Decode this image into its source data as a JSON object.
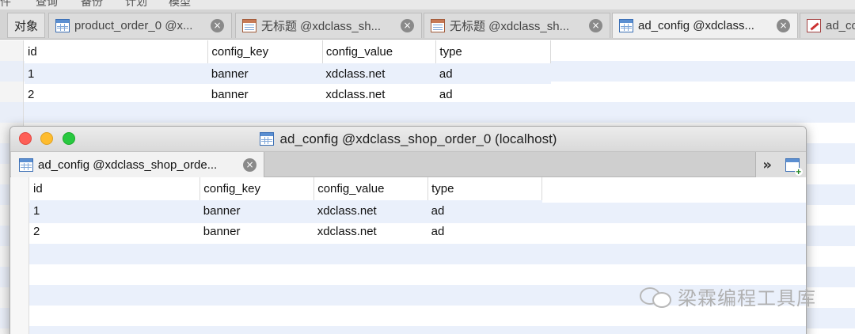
{
  "menubar": {
    "items": [
      "件",
      "查询",
      "备份",
      "计划",
      "模型"
    ]
  },
  "object_tab": {
    "label": "对象"
  },
  "bg_tabs": [
    {
      "label": "product_order_0 @x...",
      "icon": "table-icon"
    },
    {
      "label": "无标题 @xdclass_sh...",
      "icon": "query-icon"
    },
    {
      "label": "无标题 @xdclass_sh...",
      "icon": "query-icon"
    },
    {
      "label": "ad_config @xdclass...",
      "icon": "table-icon"
    },
    {
      "label": "ad_co",
      "icon": "edit-icon"
    }
  ],
  "bg_table": {
    "columns": [
      "id",
      "config_key",
      "config_value",
      "type"
    ],
    "rows": [
      [
        "1",
        "banner",
        "xdclass.net",
        "ad"
      ],
      [
        "2",
        "banner",
        "xdclass.net",
        "ad"
      ]
    ]
  },
  "window": {
    "title": "ad_config @xdclass_shop_order_0 (localhost)",
    "tab_label": "ad_config @xdclass_shop_orde...",
    "tools": {
      "more": "»"
    },
    "table": {
      "columns": [
        "id",
        "config_key",
        "config_value",
        "type"
      ],
      "rows": [
        [
          "1",
          "banner",
          "xdclass.net",
          "ad"
        ],
        [
          "2",
          "banner",
          "xdclass.net",
          "ad"
        ]
      ]
    }
  },
  "watermark": {
    "text": "梁霖编程工具库"
  },
  "colors": {
    "stripe": "#eaf0fb",
    "close_red": "#fe5f57",
    "min_yellow": "#febc2e",
    "max_green": "#28c840"
  }
}
